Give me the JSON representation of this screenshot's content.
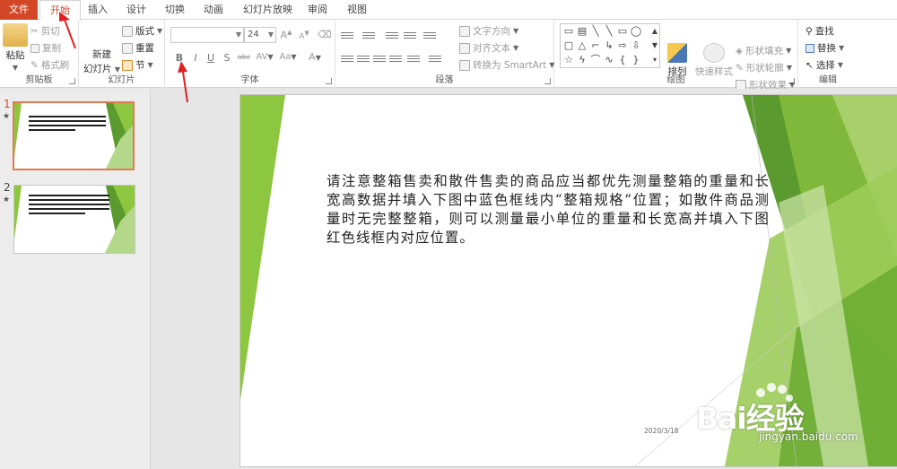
{
  "tabs": [
    "文件",
    "开始",
    "插入",
    "设计",
    "切换",
    "动画",
    "幻灯片放映",
    "审阅",
    "视图"
  ],
  "clipboard": {
    "paste": "粘贴",
    "cut": "剪切",
    "copy": "复制",
    "format_painter": "格式刷",
    "label": "剪贴板"
  },
  "slides_group": {
    "new_slide_line1": "新建",
    "new_slide_line2": "幻灯片",
    "layout": "版式",
    "reset": "重置",
    "section": "节",
    "label": "幻灯片"
  },
  "font": {
    "font_name": "",
    "font_size": "24",
    "grow": "A",
    "shrink": "A",
    "bold": "B",
    "italic": "I",
    "underline": "U",
    "strike": "S",
    "abc": "abc",
    "spacing": "AV",
    "case": "Aa",
    "color": "A",
    "label": "字体"
  },
  "paragraph": {
    "text_direction": "文字方向",
    "align_text": "对齐文本",
    "convert_smartart": "转换为 SmartArt",
    "label": "段落"
  },
  "drawing": {
    "arrange": "排列",
    "quick_styles": "快速样式",
    "shape_fill": "形状填充",
    "shape_outline": "形状轮廓",
    "shape_effects": "形状效果",
    "label": "绘图"
  },
  "editing": {
    "find": "查找",
    "replace": "替换",
    "select": "选择",
    "label": "编辑"
  },
  "thumbnails": [
    {
      "num": "1",
      "star": "★"
    },
    {
      "num": "2",
      "star": "★"
    }
  ],
  "slide": {
    "body": "请注意整箱售卖和散件售卖的商品应当都优先测量整箱的重量和长宽高数据并填入下图中蓝色框线内“整箱规格”位置；如散件商品测量时无完整整箱，则可以测量最小单位的重量和长宽高并填入下图红色线框内对应位置。",
    "date": "2020/3/18"
  },
  "watermark": {
    "brand": "Bai经验",
    "url": "jingyan.baidu.com"
  },
  "colors": {
    "accent": "#d24726",
    "annotation_arrow": "#e02020",
    "slide_green_light": "#8dc63f",
    "slide_green_dark": "#5a9a2e"
  }
}
